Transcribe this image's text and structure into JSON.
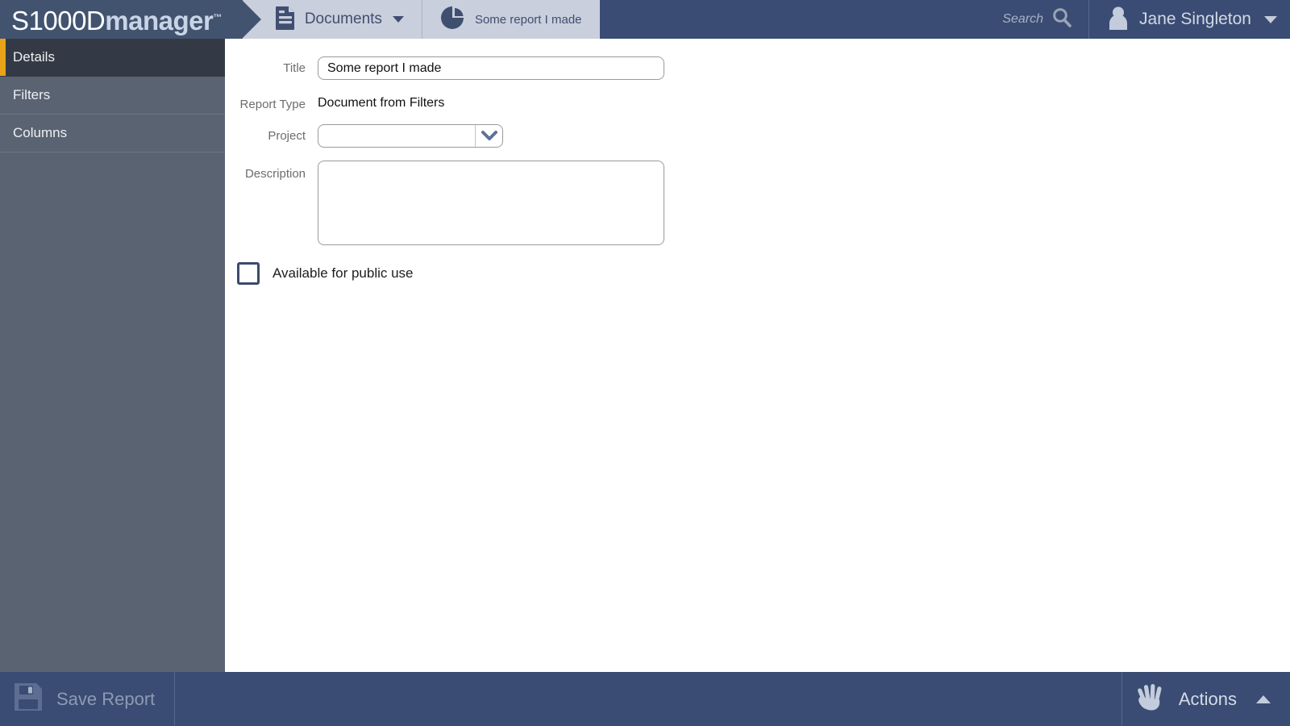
{
  "header": {
    "logo": {
      "light": "S1000D",
      "bold": "manager",
      "tm": "™"
    },
    "tabs": [
      {
        "label": "Documents",
        "icon": "document-icon",
        "has_caret": true
      },
      {
        "label": "Some report I made",
        "icon": "pie-chart-icon",
        "has_caret": false
      }
    ],
    "search": {
      "label": "Search",
      "icon": "search-icon"
    },
    "user": {
      "name": "Jane Singleton",
      "icon": "user-avatar-icon",
      "caret": "chevron-down-icon"
    }
  },
  "sidebar": {
    "items": [
      {
        "label": "Details",
        "active": true
      },
      {
        "label": "Filters",
        "active": false
      },
      {
        "label": "Columns",
        "active": false
      }
    ],
    "accent_color": "#e8a317"
  },
  "main": {
    "fields": {
      "title": {
        "label": "Title",
        "value": "Some report I made",
        "placeholder": ""
      },
      "report_type": {
        "label": "Report Type",
        "value": "Document from Filters"
      },
      "project": {
        "label": "Project",
        "value": "",
        "placeholder": ""
      },
      "description": {
        "label": "Description",
        "value": "",
        "placeholder": ""
      }
    },
    "checkbox": {
      "label": "Available for public use",
      "checked": false
    }
  },
  "footer": {
    "save": {
      "label": "Save Report",
      "icon": "floppy-disk-icon",
      "disabled": true
    },
    "actions": {
      "label": "Actions",
      "icon": "hand-icon",
      "caret": "chevron-up-icon"
    }
  },
  "colors": {
    "header_bg": "#3a4c73",
    "tabstrip_bg": "#c9cfdc",
    "sidebar_bg": "#5a6371",
    "sidebar_active_bg": "#343a45",
    "accent": "#e8a317",
    "footer_bg": "#3a4c73"
  }
}
